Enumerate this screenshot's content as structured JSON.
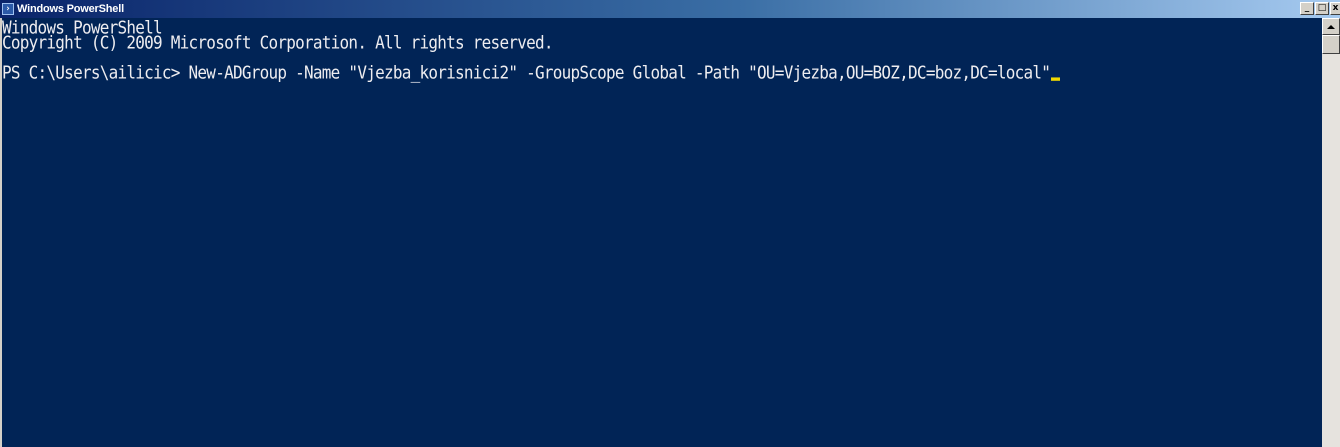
{
  "window": {
    "title": "Windows PowerShell",
    "buttons": {
      "minimize": "_",
      "maximize": "□",
      "close": "x"
    }
  },
  "console": {
    "lines": [
      "Windows PowerShell",
      "Copyright (C) 2009 Microsoft Corporation. All rights reserved.",
      "",
      "PS C:\\Users\\ailicic> New-ADGroup -Name \"Vjezba_korisnici2\" -GroupScope Global -Path \"OU=Vjezba,OU=BOZ,DC=boz,DC=local\""
    ],
    "background_color": "#012456",
    "text_color": "#eeedf0",
    "cursor_color": "#f2d900"
  },
  "icons": {
    "app": "powershell-icon",
    "scroll_up": "scroll-up-arrow-icon"
  }
}
